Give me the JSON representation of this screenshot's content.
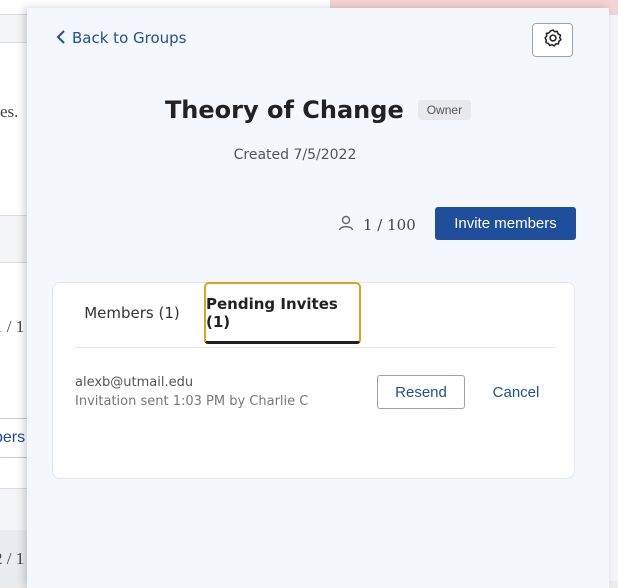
{
  "background": {
    "fragment_1": "es.",
    "fragment_2": "1 / 1",
    "fragment_3": "bers",
    "fragment_4": "2 / 1"
  },
  "drawer": {
    "back_label": "Back to Groups",
    "group_title": "Theory of Change",
    "role_badge": "Owner",
    "created_text": "Created 7/5/2022",
    "member_count": "1 / 100",
    "invite_button_label": "Invite members"
  },
  "tabs": {
    "members_label": "Members (1)",
    "pending_label": "Pending Invites (1)"
  },
  "pending_invites": [
    {
      "email": "alexb@utmail.edu",
      "meta": "Invitation sent 1:03 PM by Charlie C",
      "resend_label": "Resend",
      "cancel_label": "Cancel"
    }
  ],
  "colors": {
    "accent": "#1f4f9c",
    "active_tab_outline": "#e2a21b"
  },
  "icons": {
    "back": "chevron-left-icon",
    "settings": "gear-icon",
    "members": "user-icon"
  }
}
